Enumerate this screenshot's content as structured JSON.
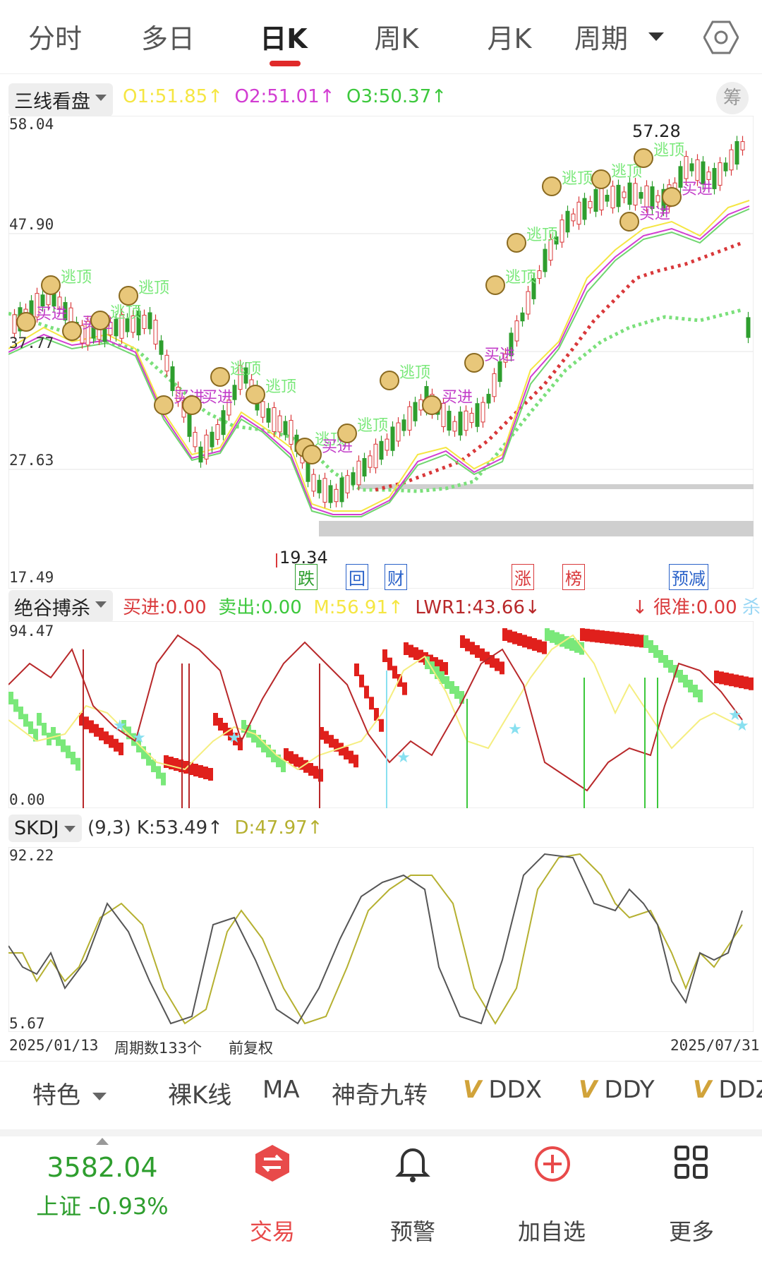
{
  "tabs": [
    "分时",
    "多日",
    "日K",
    "周K",
    "月K",
    "周期"
  ],
  "active_tab": "日K",
  "main_panel": {
    "indicator": "三线看盘",
    "legend": [
      {
        "text": "O1:51.85↑",
        "color": "#f5e642"
      },
      {
        "text": "O2:51.01↑",
        "color": "#d23cd2"
      },
      {
        "text": "O3:50.37↑",
        "color": "#3cc83c"
      }
    ],
    "chip_button": "筹",
    "y_axis": [
      "58.04",
      "47.90",
      "37.77",
      "27.63",
      "17.49"
    ],
    "max_label": "57.28",
    "min_label": "19.34",
    "event_tags": [
      {
        "text": "跌",
        "color": "#2e9e2e"
      },
      {
        "text": "回",
        "color": "#2a62c9"
      },
      {
        "text": "财",
        "color": "#2a62c9"
      },
      {
        "text": "涨",
        "color": "#d9383a"
      },
      {
        "text": "榜",
        "color": "#d9383a"
      },
      {
        "text": "预减",
        "color": "#2a62c9"
      }
    ],
    "signal_labels": {
      "buy": "买进",
      "top": "逃顶"
    }
  },
  "sub_panel_1": {
    "indicator": "绝谷搏杀",
    "legend": [
      {
        "text": "买进:0.00",
        "color": "#d9383a"
      },
      {
        "text": "卖出:0.00",
        "color": "#3cc83c"
      },
      {
        "text": "M:56.91↑",
        "color": "#f5e642"
      },
      {
        "text": "LWR1:43.66↓",
        "color": "#b8282a"
      }
    ],
    "right_legend": {
      "text": "↓ 很准:0.00",
      "color": "#d9383a"
    },
    "right_suffix": {
      "text": "杀",
      "color": "#9ad7f5"
    },
    "y_axis": [
      "94.47",
      "0.00"
    ]
  },
  "sub_panel_2": {
    "indicator": "SKDJ",
    "legend": [
      {
        "text": "(9,3) K:53.49↑",
        "color": "#333333"
      },
      {
        "text": "D:47.97↑",
        "color": "#b5b030"
      }
    ],
    "y_axis": [
      "92.22",
      "5.67"
    ]
  },
  "footer_axis": {
    "start_date": "2025/01/13",
    "period_count": "周期数133个",
    "adjust": "前复权",
    "end_date": "2025/07/31"
  },
  "feature_bar": {
    "special": "特色",
    "items": [
      "裸K线",
      "MA",
      "神奇九转"
    ],
    "v_items": [
      "DDX",
      "DDY",
      "DDZ"
    ]
  },
  "bottom_nav": {
    "index_value": "3582.04",
    "index_name": "上证 -0.93%",
    "trade": "交易",
    "alert": "预警",
    "add_watch": "加自选",
    "more": "更多"
  }
}
